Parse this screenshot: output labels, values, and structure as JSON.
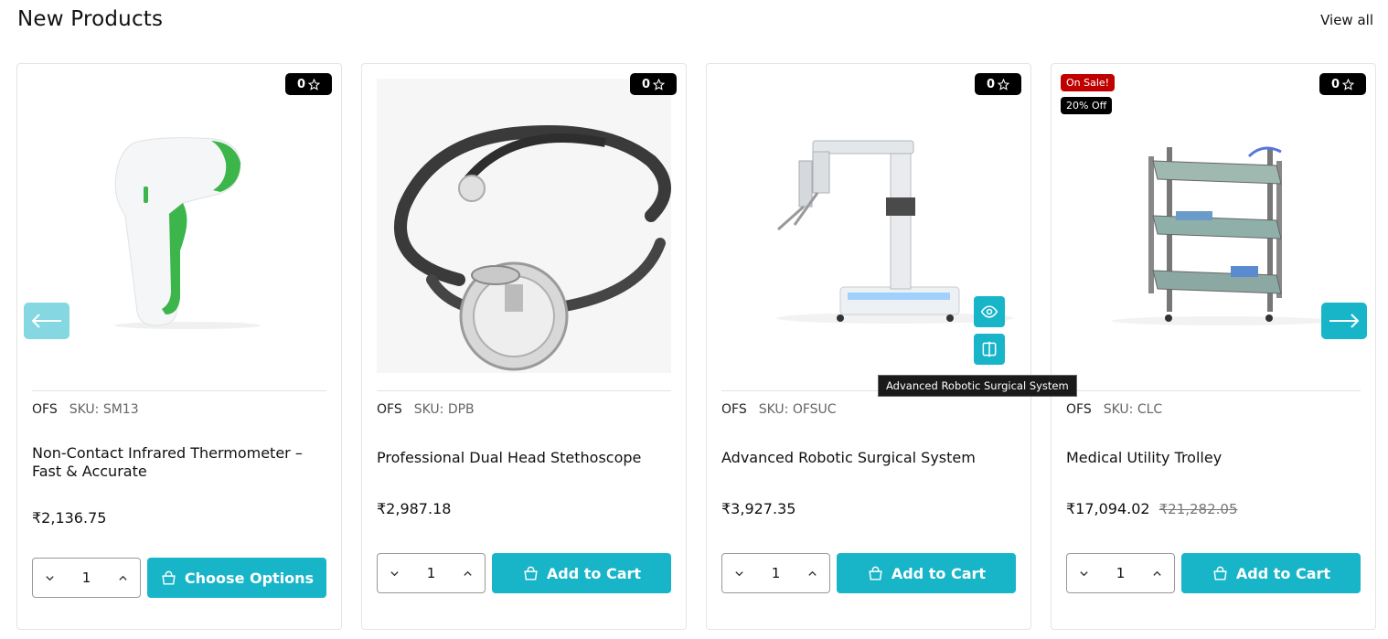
{
  "section": {
    "title": "New Products",
    "view_all": "View all"
  },
  "products": [
    {
      "rating": "0",
      "brand": "OFS",
      "sku": "SKU: SM13",
      "title": "Non-Contact Infrared Thermometer – Fast & Accurate",
      "price": "₹2,136.75",
      "qty": "1",
      "button": "Choose Options"
    },
    {
      "rating": "0",
      "brand": "OFS",
      "sku": "SKU: DPB",
      "title": "Professional Dual Head Stethoscope",
      "price": "₹2,987.18",
      "qty": "1",
      "button": "Add to Cart"
    },
    {
      "rating": "0",
      "brand": "OFS",
      "sku": "SKU: OFSUC",
      "title": "Advanced Robotic Surgical System",
      "price": "₹3,927.35",
      "qty": "1",
      "button": "Add to Cart",
      "tooltip": "Advanced Robotic Surgical System"
    },
    {
      "rating": "0",
      "brand": "OFS",
      "sku": "SKU: CLC",
      "title": "Medical Utility Trolley",
      "price": "₹17,094.02",
      "old_price": "₹21,282.05",
      "sale_badge": "On Sale!",
      "discount_badge": "20% Off",
      "qty": "1",
      "button": "Add to Cart"
    }
  ],
  "colors": {
    "accent": "#18b5c9",
    "accent_light": "#85d8e2",
    "sale": "#c00000"
  },
  "icons": [
    "star-outline-icon",
    "chevron-down-icon",
    "chevron-up-icon",
    "shopping-bag-icon",
    "eye-icon",
    "compare-icon",
    "arrow-left-icon",
    "arrow-right-icon"
  ]
}
